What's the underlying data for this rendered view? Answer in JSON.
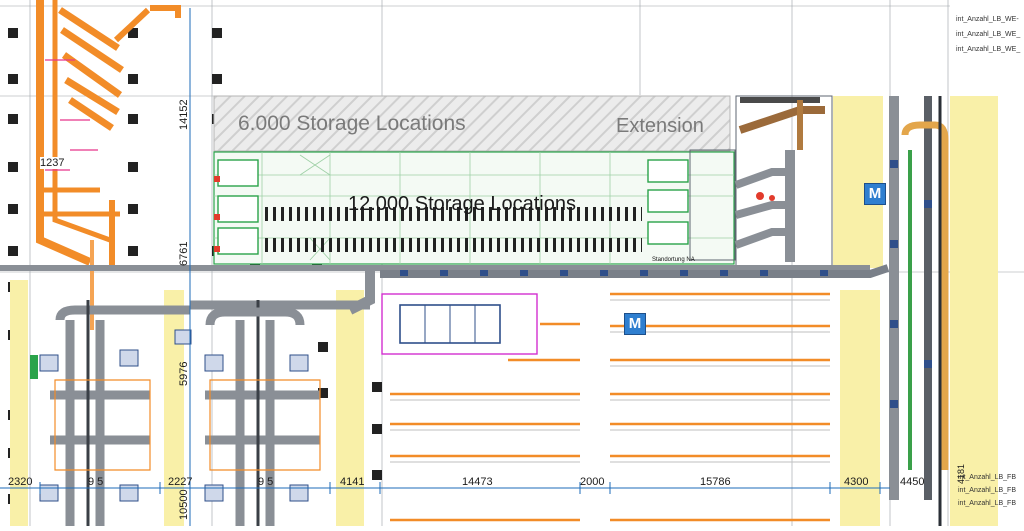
{
  "labels": {
    "storage_6000": "6.000 Storage Locations",
    "extension": "Extension",
    "storage_12000": "12.000 Storage Locations",
    "small_label": "Standortung NA"
  },
  "badges": {
    "m1": "M",
    "m2": "M"
  },
  "dimensions": {
    "d2320": "2320",
    "d915": "9 5",
    "d2227": "2227",
    "d2915": "9 5",
    "d4141": "4141",
    "d14473": "14473",
    "d2000": "2000",
    "d15786": "15786",
    "d4300": "4300",
    "d4450": "4450",
    "d1237": "1237",
    "v14152": "14152",
    "v6761": "6761",
    "v5976": "5976",
    "v10500": "10500",
    "v4181": "4181"
  },
  "layer_list_top": [
    "int_Anzahl_LB_WE-",
    "int_Anzahl_LB_WE_",
    "int_Anzahl_LB_WE_"
  ],
  "layer_list_bottom": [
    "int_Anzahl_LB_FB",
    "int_Anzahl_LB_FB",
    "int_Anzahl_LB_FB"
  ],
  "colors": {
    "conveyor": "#8a8f96",
    "conveyor_dark": "#3a3f46",
    "orange": "#f28c28",
    "yellow_zone": "#f9f0a8",
    "green": "#2aa34a",
    "blue": "#2f7fd0",
    "magenta": "#d22fd0",
    "hatch": "#c9c9c9"
  }
}
